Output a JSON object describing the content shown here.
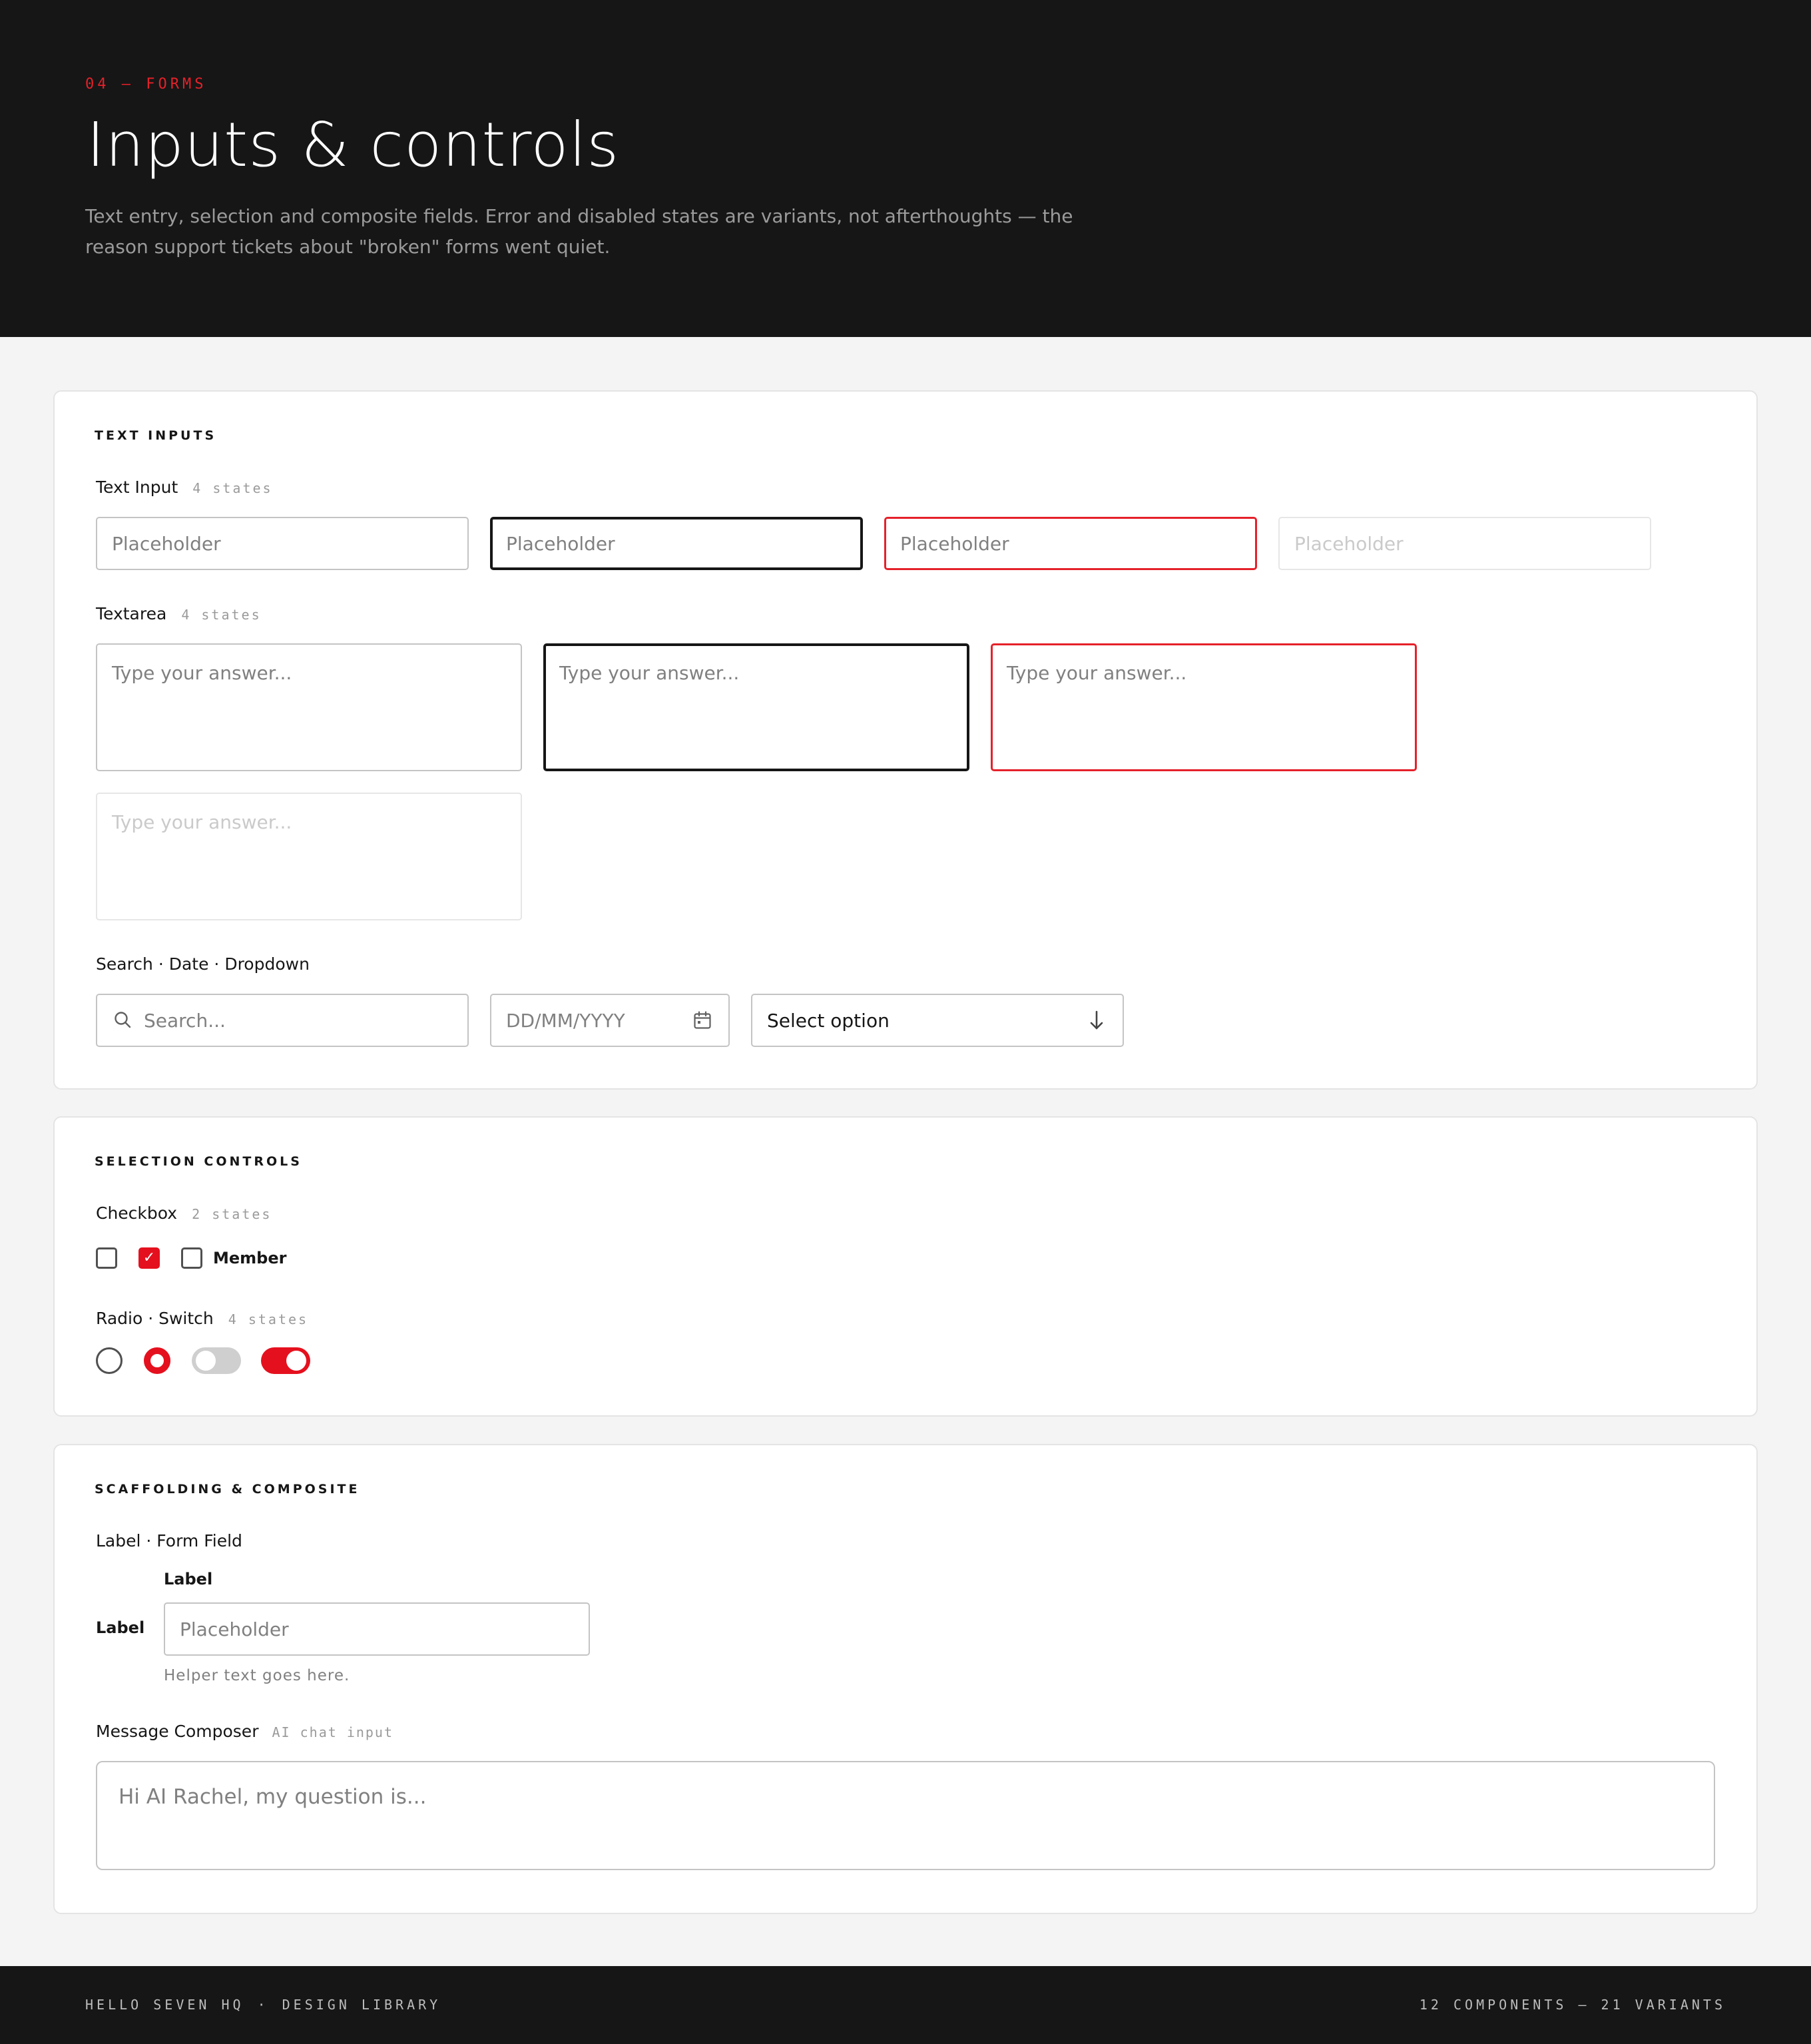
{
  "header": {
    "eyebrow": "04 — FORMS",
    "title": "Inputs & controls",
    "description": "Text entry, selection and composite fields. Error and disabled states are variants, not afterthoughts — the reason support tickets about \"broken\" forms went quiet."
  },
  "text_inputs": {
    "section_title": "TEXT INPUTS",
    "text_input": {
      "label": "Text Input",
      "meta": "4 states",
      "states": [
        {
          "state": "default",
          "placeholder": "Placeholder"
        },
        {
          "state": "focus",
          "placeholder": "Placeholder"
        },
        {
          "state": "error",
          "placeholder": "Placeholder"
        },
        {
          "state": "disabled",
          "placeholder": "Placeholder"
        }
      ]
    },
    "textarea": {
      "label": "Textarea",
      "meta": "4 states",
      "states": [
        {
          "state": "default",
          "placeholder": "Type your answer..."
        },
        {
          "state": "focus",
          "placeholder": "Type your answer..."
        },
        {
          "state": "error",
          "placeholder": "Type your answer..."
        },
        {
          "state": "disabled",
          "placeholder": "Type your answer..."
        }
      ]
    },
    "search_date_dropdown": {
      "label": "Search · Date · Dropdown",
      "search_placeholder": "Search...",
      "date_placeholder": "DD/MM/YYYY",
      "dropdown_value": "Select option"
    }
  },
  "selection_controls": {
    "section_title": "SELECTION CONTROLS",
    "checkbox": {
      "label": "Checkbox",
      "meta": "2 states",
      "member_label": "Member"
    },
    "radio_switch": {
      "label": "Radio · Switch",
      "meta": "4 states"
    }
  },
  "scaffolding": {
    "section_title": "SCAFFOLDING & COMPOSITE",
    "label_form_field": {
      "label": "Label · Form Field",
      "top_label": "Label",
      "side_label": "Label",
      "placeholder": "Placeholder",
      "helper": "Helper text goes here."
    },
    "message_composer": {
      "label": "Message Composer",
      "meta": "AI chat input",
      "placeholder": "Hi AI Rachel, my question is..."
    }
  },
  "footer": {
    "brand": "HELLO SEVEN HQ",
    "separator": "·",
    "section": "DESIGN LIBRARY",
    "stats": "12 COMPONENTS — 21 VARIANTS"
  },
  "colors": {
    "accent": "#e5101e",
    "dark": "#161616",
    "page_bg": "#f4f4f4"
  }
}
